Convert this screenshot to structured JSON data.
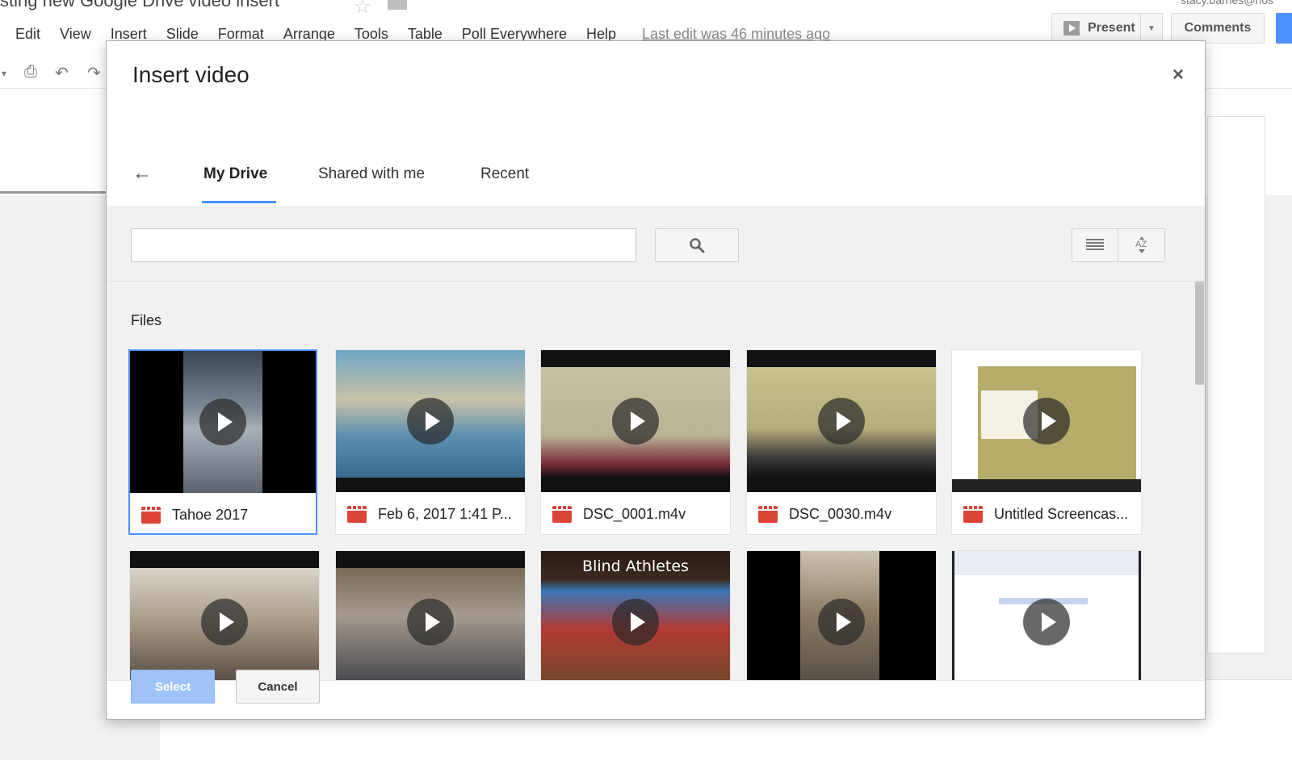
{
  "app": {
    "doc_title": "sting new Google Drive video insert",
    "user_email": "stacy.barnes@nos",
    "menu": [
      "Edit",
      "View",
      "Insert",
      "Slide",
      "Format",
      "Arrange",
      "Tools",
      "Table",
      "Poll Everywhere",
      "Help"
    ],
    "last_edit": "Last edit was 46 minutes ago",
    "present_label": "Present",
    "comments_label": "Comments"
  },
  "modal": {
    "title": "Insert video",
    "close_label": "×",
    "back_label": "←",
    "tabs": [
      "My Drive",
      "Shared with me",
      "Recent"
    ],
    "active_tab": "My Drive",
    "search": {
      "value": "",
      "placeholder": ""
    },
    "files_heading": "Files",
    "files": [
      {
        "name": "Tahoe 2017",
        "selected": true
      },
      {
        "name": "Feb 6, 2017 1:41 P..."
      },
      {
        "name": "DSC_0001.m4v"
      },
      {
        "name": "DSC_0030.m4v"
      },
      {
        "name": "Untitled Screencas..."
      },
      {
        "name": ""
      },
      {
        "name": ""
      },
      {
        "name": "",
        "overlay_text": "Blind Athletes"
      },
      {
        "name": ""
      },
      {
        "name": ""
      }
    ],
    "select_label": "Select",
    "cancel_label": "Cancel"
  },
  "colors": {
    "accent": "#4d90fe",
    "video_icon": "#db4437",
    "select_disabled": "#9fc3f9"
  }
}
